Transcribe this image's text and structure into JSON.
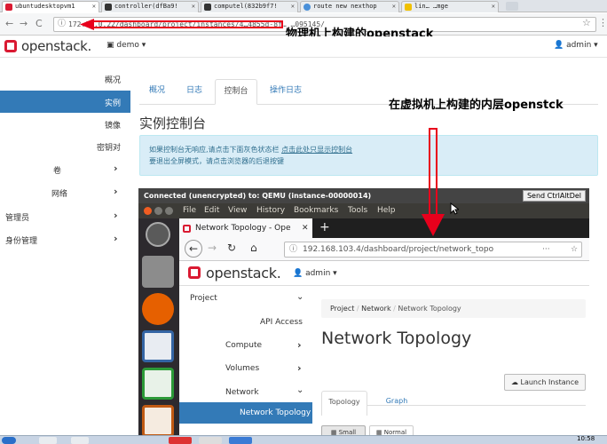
{
  "outer_tabs": [
    {
      "label": "ubuntudesktopvm1",
      "fav_color": "#da1a32"
    },
    {
      "label": "controller(dfBa9!",
      "fav_color": "#333"
    },
    {
      "label": "computel(832b9f7!",
      "fav_color": "#333"
    },
    {
      "label": "route new nexthop",
      "fav_color": "#4a90d9"
    },
    {
      "label": "lin…  …mge",
      "fav_color": "#f0c000"
    }
  ],
  "outer_url": "172.16.0.22/dashboard/project/instances/4…4855d-8f…  …095145/",
  "outer_header": {
    "logo": "openstack.",
    "project": "demo",
    "user": "admin"
  },
  "outer_sidebar": [
    {
      "label": "概况"
    },
    {
      "label": "实例"
    },
    {
      "label": "镜像"
    },
    {
      "label": "密钥对"
    },
    {
      "label": "卷"
    },
    {
      "label": "网络"
    },
    {
      "label": "管理员"
    },
    {
      "label": "身份管理"
    }
  ],
  "outer_tabs_row": [
    "概况",
    "日志",
    "控制台",
    "操作日志"
  ],
  "outer_title": "实例控制台",
  "notice": {
    "line1": "如果控制台无响应,请点击下面灰色状态栏",
    "link": "点击此处只显示控制台",
    "line2": "要退出全屏模式，请点击浏览器的后退按键"
  },
  "annotations": {
    "physical": "物理机上构建的openstack",
    "virtual": "在虚拟机上构建的内层openstck"
  },
  "vm": {
    "status": "Connected (unencrypted) to: QEMU (instance-00000014)",
    "send_button": "Send CtrlAltDel",
    "menu": [
      "File",
      "Edit",
      "View",
      "History",
      "Bookmarks",
      "Tools",
      "Help"
    ],
    "ff_tab": "Network Topology - Ope",
    "ff_url": "192.168.103.4/dashboard/project/network_topo",
    "logo": "openstack.",
    "user": "admin",
    "sidebar": [
      {
        "label": "Project"
      },
      {
        "label": "API Access"
      },
      {
        "label": "Compute"
      },
      {
        "label": "Volumes"
      },
      {
        "label": "Network"
      },
      {
        "label": "Network Topology"
      }
    ],
    "breadcrumb": [
      "Project",
      "Network",
      "Network Topology"
    ],
    "page_title": "Network Topology",
    "launch_button": "Launch Instance",
    "tabs": [
      "Topology",
      "Graph"
    ],
    "buttons": [
      "Small",
      "Normal"
    ]
  },
  "taskbar": {
    "time": "10:58"
  },
  "colors": {
    "openstack_red": "#da1a32",
    "sidebar_active": "#337ab7",
    "annotation_red": "#e8001c"
  }
}
